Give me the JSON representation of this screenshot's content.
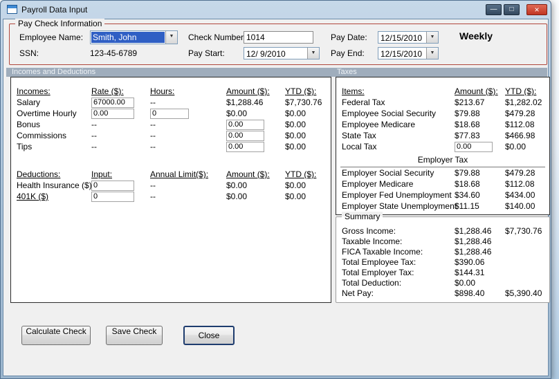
{
  "window": {
    "title": "Payroll Data Input",
    "minimize_glyph": "—",
    "maximize_glyph": "□",
    "close_glyph": "×"
  },
  "icons": {
    "dropdown": "▼"
  },
  "paycheck": {
    "group_title": "Pay Check Information",
    "employee_name_label": "Employee Name:",
    "employee_name_value": "Smith, John",
    "ssn_label": "SSN:",
    "ssn_value": "123-45-6789",
    "check_number_label": "Check Number:",
    "check_number_value": "1014",
    "pay_start_label": "Pay Start:",
    "pay_start_value": "12/ 9/2010",
    "pay_date_label": "Pay Date:",
    "pay_date_value": "12/15/2010",
    "pay_end_label": "Pay End:",
    "pay_end_value": "12/15/2010",
    "frequency": "Weekly"
  },
  "sections": {
    "incomes_header": "Incomes and Deductions",
    "taxes_header": "Taxes"
  },
  "incomes": {
    "columns": [
      "Incomes:",
      "Rate ($):",
      "Hours:",
      "Amount ($):",
      "YTD ($):"
    ],
    "rows": [
      {
        "label": "Salary",
        "rate": "67000.00",
        "hours": "--",
        "amount": "$1,288.46",
        "ytd": "$7,730.76"
      },
      {
        "label": "Overtime Hourly",
        "rate": "0.00",
        "hours": "0",
        "amount": "$0.00",
        "ytd": "$0.00"
      },
      {
        "label": "Bonus",
        "rate": "--",
        "hours": "--",
        "amount": "0.00",
        "ytd": "$0.00"
      },
      {
        "label": "Commissions",
        "rate": "--",
        "hours": "--",
        "amount": "0.00",
        "ytd": "$0.00"
      },
      {
        "label": "Tips",
        "rate": "--",
        "hours": "--",
        "amount": "0.00",
        "ytd": "$0.00"
      }
    ]
  },
  "deductions": {
    "columns": [
      "Deductions:",
      "Input:",
      "Annual Limit($):",
      "Amount ($):",
      "YTD ($):"
    ],
    "rows": [
      {
        "label": "Health Insurance ($)",
        "input": "0",
        "limit": "--",
        "amount": "$0.00",
        "ytd": "$0.00"
      },
      {
        "label": "401K ($)",
        "input": "0",
        "limit": "--",
        "amount": "$0.00",
        "ytd": "$0.00"
      }
    ]
  },
  "taxes": {
    "columns": [
      "Items:",
      "Amount ($):",
      "YTD ($):"
    ],
    "rows": [
      {
        "label": "Federal Tax",
        "amount": "$213.67",
        "ytd": "$1,282.02"
      },
      {
        "label": "Employee Social Security",
        "amount": "$79.88",
        "ytd": "$479.28"
      },
      {
        "label": "Employee Medicare",
        "amount": "$18.68",
        "ytd": "$112.08"
      },
      {
        "label": "State Tax",
        "amount": "$77.83",
        "ytd": "$466.98"
      },
      {
        "label": "Local Tax",
        "amount": "0.00",
        "ytd": "$0.00"
      }
    ],
    "employer_header": "Employer Tax",
    "employer_rows": [
      {
        "label": "Employer Social Security",
        "amount": "$79.88",
        "ytd": "$479.28"
      },
      {
        "label": "Employer Medicare",
        "amount": "$18.68",
        "ytd": "$112.08"
      },
      {
        "label": "Employer Fed Unemployment",
        "amount": "$34.60",
        "ytd": "$434.00"
      },
      {
        "label": "Employer State Unemployment",
        "amount": "$11.15",
        "ytd": "$140.00"
      }
    ]
  },
  "summary": {
    "group_title": "Summary",
    "rows": [
      {
        "label": "Gross Income:",
        "amount": "$1,288.46",
        "ytd": "$7,730.76"
      },
      {
        "label": "Taxable Income:",
        "amount": "$1,288.46",
        "ytd": ""
      },
      {
        "label": "FICA Taxable Income:",
        "amount": "$1,288.46",
        "ytd": ""
      },
      {
        "label": "Total Employee Tax:",
        "amount": "$390.06",
        "ytd": ""
      },
      {
        "label": "Total Employer Tax:",
        "amount": "$144.31",
        "ytd": ""
      },
      {
        "label": "Total Deduction:",
        "amount": "$0.00",
        "ytd": ""
      },
      {
        "label": "Net Pay:",
        "amount": "$898.40",
        "ytd": "$5,390.40"
      }
    ]
  },
  "buttons": {
    "calculate": "Calculate Check",
    "save": "Save Check",
    "close": "Close"
  },
  "colors": {
    "paycheck_border": "#b0473c",
    "section_header_bg": "#9fadbc",
    "selection_bg": "#2f5fc4",
    "close_button_red": "#c03522"
  }
}
